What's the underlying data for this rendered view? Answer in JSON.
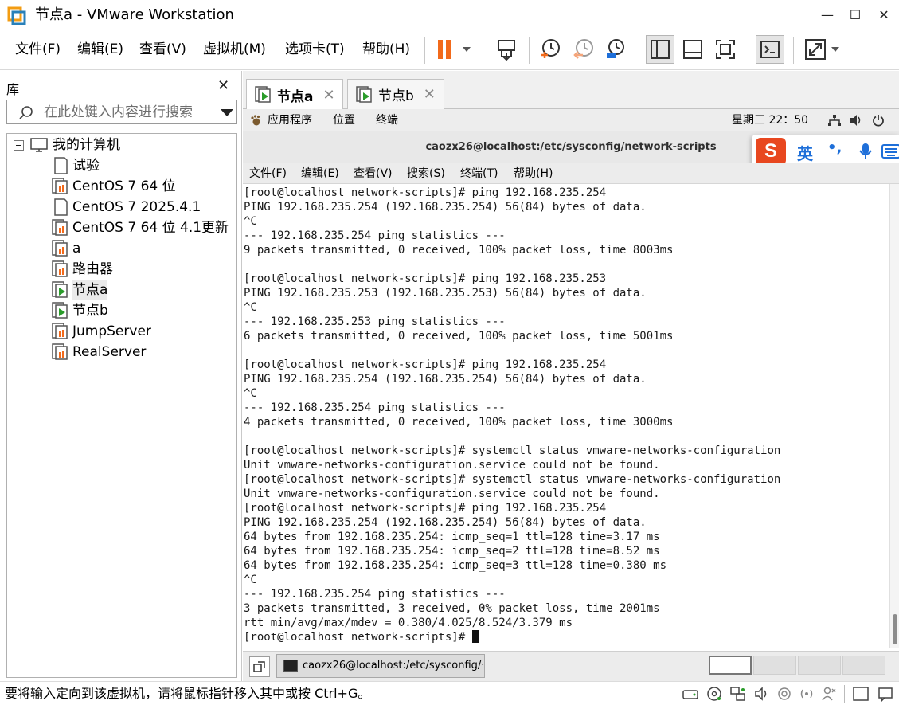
{
  "window": {
    "title": "节点a - VMware Workstation",
    "minimize_glyph": "—",
    "maximize_glyph": "☐",
    "close_glyph": "✕"
  },
  "menu": {
    "items": [
      "文件(F)",
      "编辑(E)",
      "查看(V)",
      "虚拟机(M)",
      "选项卡(T)",
      "帮助(H)"
    ]
  },
  "toolbar": {
    "icons": [
      "pause-icon",
      "send-ctrl-alt-del-icon",
      "snapshot-take-icon",
      "snapshot-revert-icon",
      "snapshot-manager-icon",
      "library-view-icon",
      "thumbnail-view-icon",
      "fullscreen-icon",
      "console-view-icon",
      "stretch-guest-icon"
    ]
  },
  "library": {
    "title": "库",
    "close_glyph": "✕",
    "search_placeholder": "在此处键入内容进行搜索",
    "tree": [
      {
        "label": "我的计算机",
        "type": "root",
        "expand_glyph": "−"
      },
      {
        "label": "试验",
        "type": "vm-off-plain"
      },
      {
        "label": "CentOS 7 64 位",
        "type": "vm-off"
      },
      {
        "label": "CentOS 7 2025.4.1",
        "type": "vm-off-plain"
      },
      {
        "label": "CentOS 7 64 位 4.1更新",
        "type": "vm-off"
      },
      {
        "label": "a",
        "type": "vm-off"
      },
      {
        "label": "路由器",
        "type": "vm-off"
      },
      {
        "label": "节点a",
        "type": "vm-running",
        "selected": true
      },
      {
        "label": "节点b",
        "type": "vm-running"
      },
      {
        "label": "JumpServer",
        "type": "vm-off"
      },
      {
        "label": "RealServer",
        "type": "vm-off"
      }
    ]
  },
  "tabs": [
    {
      "label": "节点a",
      "active": true,
      "close_glyph": "✕"
    },
    {
      "label": "节点b",
      "active": false,
      "close_glyph": "✕"
    }
  ],
  "guest": {
    "top_bar": {
      "applications": "应用程序",
      "places": "位置",
      "terminal": "终端",
      "clock": "星期三 22：50"
    },
    "terminal": {
      "title": "caozx26@localhost:/etc/sysconfig/network-scripts",
      "menu": [
        "文件(F)",
        "编辑(E)",
        "查看(V)",
        "搜索(S)",
        "终端(T)",
        "帮助(H)"
      ],
      "lines": [
        "[root@localhost network-scripts]# ping 192.168.235.254",
        "PING 192.168.235.254 (192.168.235.254) 56(84) bytes of data.",
        "^C",
        "--- 192.168.235.254 ping statistics ---",
        "9 packets transmitted, 0 received, 100% packet loss, time 8003ms",
        "",
        "[root@localhost network-scripts]# ping 192.168.235.253",
        "PING 192.168.235.253 (192.168.235.253) 56(84) bytes of data.",
        "^C",
        "--- 192.168.235.253 ping statistics ---",
        "6 packets transmitted, 0 received, 100% packet loss, time 5001ms",
        "",
        "[root@localhost network-scripts]# ping 192.168.235.254",
        "PING 192.168.235.254 (192.168.235.254) 56(84) bytes of data.",
        "^C",
        "--- 192.168.235.254 ping statistics ---",
        "4 packets transmitted, 0 received, 100% packet loss, time 3000ms",
        "",
        "[root@localhost network-scripts]# systemctl status vmware-networks-configuration",
        "Unit vmware-networks-configuration.service could not be found.",
        "[root@localhost network-scripts]# systemctl status vmware-networks-configuration",
        "Unit vmware-networks-configuration.service could not be found.",
        "[root@localhost network-scripts]# ping 192.168.235.254",
        "PING 192.168.235.254 (192.168.235.254) 56(84) bytes of data.",
        "64 bytes from 192.168.235.254: icmp_seq=1 ttl=128 time=3.17 ms",
        "64 bytes from 192.168.235.254: icmp_seq=2 ttl=128 time=8.52 ms",
        "64 bytes from 192.168.235.254: icmp_seq=3 ttl=128 time=0.380 ms",
        "^C",
        "--- 192.168.235.254 ping statistics ---",
        "3 packets transmitted, 3 received, 0% packet loss, time 2001ms",
        "rtt min/avg/max/mdev = 0.380/4.025/8.524/3.379 ms"
      ],
      "prompt": "[root@localhost network-scripts]# "
    },
    "ime": {
      "logo": "S",
      "mode": "英",
      "punct": "•,"
    },
    "taskbar": {
      "task_label": "caozx26@localhost:/etc/sysconfig/···"
    }
  },
  "status": {
    "text": "要将输入定向到该虚拟机，请将鼠标指针移入其中或按 Ctrl+G。"
  },
  "colors": {
    "accent_orange": "#f26a1b",
    "running_green": "#2a9c2a",
    "sogou_red": "#e8471f",
    "ime_blue": "#1e6fd9"
  }
}
